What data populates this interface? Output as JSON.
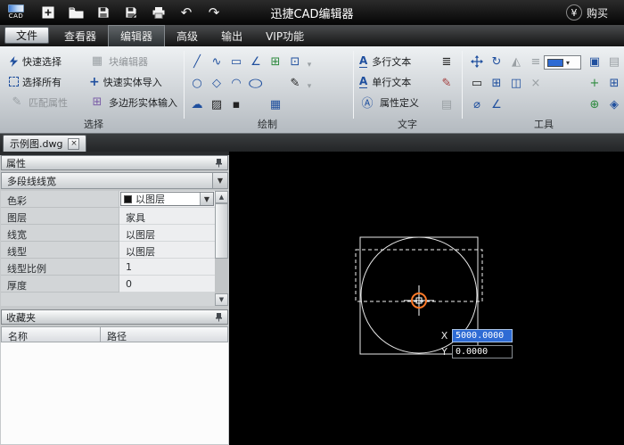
{
  "titlebar": {
    "logo_text": "CAD",
    "title": "迅捷CAD编辑器",
    "buy_symbol": "¥",
    "buy_label": "购买"
  },
  "menubar": {
    "active_tab": "编辑器",
    "tabs": [
      {
        "label": "文件"
      },
      {
        "label": "查看器"
      },
      {
        "label": "编辑器"
      },
      {
        "label": "高级"
      },
      {
        "label": "输出"
      },
      {
        "label": "VIP功能"
      }
    ]
  },
  "ribbon": {
    "groups": [
      {
        "label": "选择"
      },
      {
        "label": "绘制"
      },
      {
        "label": "文字"
      },
      {
        "label": "工具"
      }
    ],
    "selection_buttons": [
      {
        "label": "快速选择",
        "enabled": true
      },
      {
        "label": "块编辑器",
        "enabled": false
      },
      {
        "label": "选择所有",
        "enabled": true
      },
      {
        "label": "快速实体导入",
        "enabled": true
      },
      {
        "label": "匹配属性",
        "enabled": false
      },
      {
        "label": "多边形实体输入",
        "enabled": true
      }
    ],
    "text_buttons": [
      {
        "label": "多行文本"
      },
      {
        "label": "单行文本"
      },
      {
        "label": "属性定义"
      }
    ]
  },
  "tabbar": {
    "tabs": [
      {
        "label": "示例图.dwg"
      }
    ]
  },
  "properties_panel": {
    "title": "属性",
    "selector": "多段线线宽",
    "rows": [
      {
        "label": "色彩",
        "value": "以图层"
      },
      {
        "label": "图层",
        "value": "家具"
      },
      {
        "label": "线宽",
        "value": "以图层"
      },
      {
        "label": "线型",
        "value": "以图层"
      },
      {
        "label": "线型比例",
        "value": "1"
      },
      {
        "label": "厚度",
        "value": "0"
      }
    ]
  },
  "favorites_panel": {
    "title": "收藏夹",
    "columns": [
      {
        "label": "名称"
      },
      {
        "label": "路径"
      }
    ]
  },
  "canvas": {
    "x_label": "X",
    "x_value": "5000.0000",
    "y_label": "Y",
    "y_value": "0.0000"
  },
  "icons": {
    "undo": "↶",
    "redo": "↷",
    "block_editor": "▦",
    "quick_import": "+",
    "match_props": "✎",
    "polygon_input": "⊞",
    "line": "╱",
    "spline": "∿",
    "rect": "▭",
    "polyline": "∠",
    "block1": "⊞",
    "block2": "⊡",
    "circle": "○",
    "polygon": "◇",
    "arc": "◠",
    "ellipse": "○",
    "pencil": "✎",
    "cloud": "☁",
    "hatch": "▨",
    "point": "▪",
    "table": "▦",
    "caret": "▾",
    "dropdown": "▼",
    "up": "▲",
    "down": "▼",
    "close": "×",
    "text_a": "A",
    "text_attr": "Ⓐ",
    "text_lines": "≣",
    "text_edit": "✎",
    "rotate": "↻",
    "mirror": "◭",
    "offset": "≡",
    "erase": "▭",
    "array": "⊞",
    "layout": "◫",
    "del": "×",
    "copy": "▣",
    "paste": "▤",
    "add": "+",
    "grid": "⊞",
    "target": "⊕",
    "pan": "◈",
    "diameter": "⌀",
    "angle": "∠"
  },
  "colors": {
    "accent_blue": "#1f4f9e",
    "selection_blue": "#2e6bd4",
    "crosshair_orange": "#ff7b2a",
    "canvas_bg": "#000000"
  }
}
